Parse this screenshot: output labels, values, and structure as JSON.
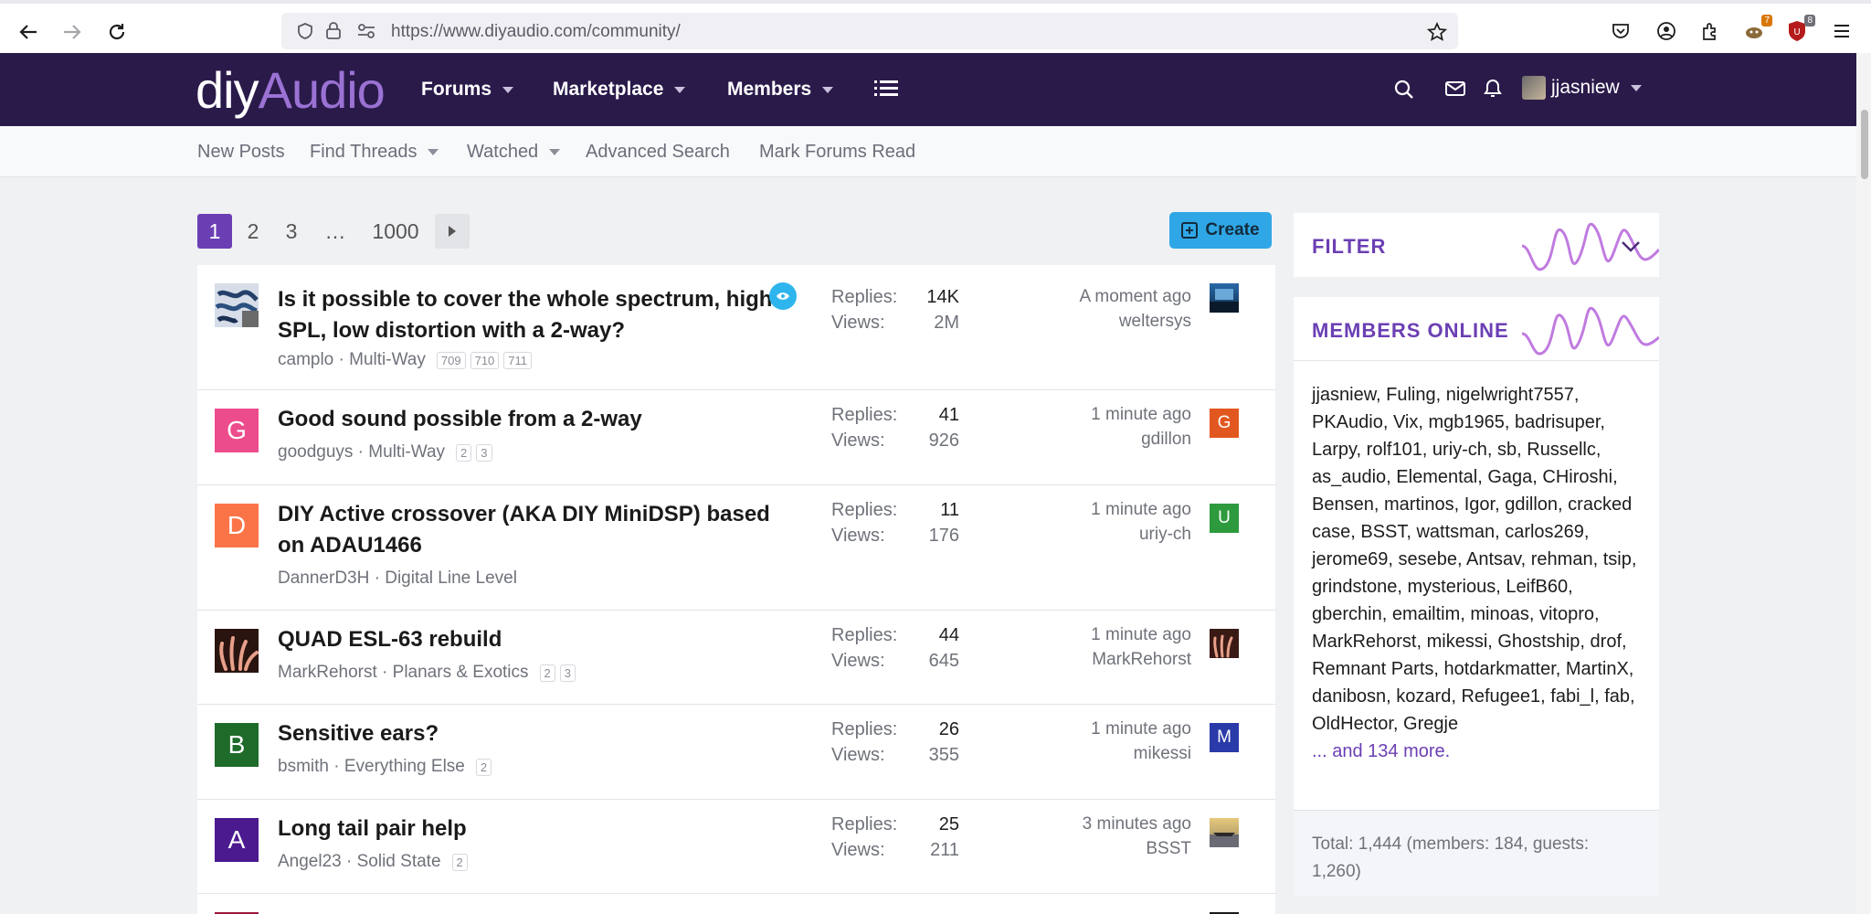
{
  "browser": {
    "url": "https://www.diyaudio.com/community/",
    "ext_badge_1": "7",
    "ext_badge_2": "8"
  },
  "site": {
    "logo_diy": "diy",
    "logo_audio": "Audio",
    "nav": [
      "Forums",
      "Marketplace",
      "Members"
    ],
    "username": "jjasniew"
  },
  "subnav": [
    "New Posts",
    "Find Threads",
    "Watched",
    "Advanced Search",
    "Mark Forums Read"
  ],
  "pagination": {
    "pages": [
      "1",
      "2",
      "3",
      "…",
      "1000"
    ],
    "create_label": "Create"
  },
  "labels": {
    "replies": "Replies:",
    "views": "Views:"
  },
  "threads": [
    {
      "title": "Is it possible to cover the whole spectrum, high SPL, low distortion with a 2-way?",
      "author": "camplo",
      "forum": "Multi-Way",
      "pages": [
        "709",
        "710",
        "711"
      ],
      "replies": "14K",
      "views": "2M",
      "time": "A moment ago",
      "last_user": "weltersys",
      "avatar_letter": "",
      "avatar_color": "#2b3b56",
      "last_letter": "",
      "last_color": "#1e4f8a",
      "watched": true
    },
    {
      "title": "Good sound possible from a 2-way",
      "author": "goodguys",
      "forum": "Multi-Way",
      "pages": [
        "2",
        "3"
      ],
      "replies": "41",
      "views": "926",
      "time": "1 minute ago",
      "last_user": "gdillon",
      "avatar_letter": "G",
      "avatar_color": "#ec4c8c",
      "last_letter": "G",
      "last_color": "#e2571f"
    },
    {
      "title": "DIY Active crossover (AKA DIY MiniDSP) based on ADAU1466",
      "author": "DannerD3H",
      "forum": "Digital Line Level",
      "pages": [],
      "replies": "11",
      "views": "176",
      "time": "1 minute ago",
      "last_user": "uriy-ch",
      "avatar_letter": "D",
      "avatar_color": "#fb7448",
      "last_letter": "U",
      "last_color": "#2c9a3d"
    },
    {
      "title": "QUAD ESL-63 rebuild",
      "author": "MarkRehorst",
      "forum": "Planars & Exotics",
      "pages": [
        "2",
        "3"
      ],
      "replies": "44",
      "views": "645",
      "time": "1 minute ago",
      "last_user": "MarkRehorst",
      "avatar_letter": "",
      "avatar_color": "#2a1410",
      "last_letter": "",
      "last_color": "#3a1a14"
    },
    {
      "title": "Sensitive ears?",
      "author": "bsmith",
      "forum": "Everything Else",
      "pages": [
        "2"
      ],
      "replies": "26",
      "views": "355",
      "time": "1 minute ago",
      "last_user": "mikessi",
      "avatar_letter": "B",
      "avatar_color": "#1f6b2a",
      "last_letter": "M",
      "last_color": "#2a3aa8"
    },
    {
      "title": "Long tail pair help",
      "author": "Angel23",
      "forum": "Solid State",
      "pages": [
        "2"
      ],
      "replies": "25",
      "views": "211",
      "time": "3 minutes ago",
      "last_user": "BSST",
      "avatar_letter": "A",
      "avatar_color": "#4b1a8e",
      "last_letter": "",
      "last_color": "#c7a857"
    }
  ],
  "sidebar": {
    "filter_title": "FILTER",
    "online_title": "MEMBERS ONLINE",
    "members": "jjasniew, Fuling, nigelwright7557, PKAudio, Vix, mgb1965, badrisuper, Larpy, rolf101, uriy-ch, sb, Russellc, as_audio, Elemental, Gaga, CHiroshi, Bensen, martinos, Igor, gdillon, cracked case, BSST, wattsman, carlos269, jerome69, sesebe, Antsav, rehman, tsip, grindstone, mysterious, LeifB60, gberchin, emailtim, minoas, vitopro, MarkRehorst, mikessi, Ghostship, drof, Remnant Parts, hotdarkmatter, MartinX, danibosn, kozard, Refugee1, fabi_l, fab, OldHector, Gregje",
    "more": "... and 134 more.",
    "total": "Total: 1,444 (members: 184, guests: 1,260)"
  }
}
